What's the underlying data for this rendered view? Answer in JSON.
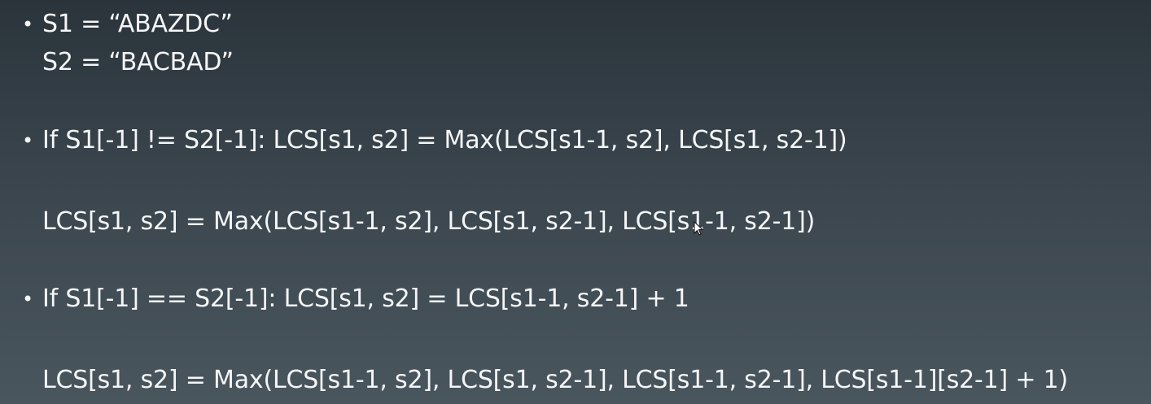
{
  "slide": {
    "bullet_symbol": "•",
    "lines": [
      "S1 =   “ABAZDC”",
      "S2 =   “BACBAD”",
      "If S1[-1] != S2[-1]: LCS[s1, s2] = Max(LCS[s1-1, s2], LCS[s1, s2-1])",
      "LCS[s1, s2] = Max(LCS[s1-1, s2], LCS[s1, s2-1], LCS[s1-1, s2-1])",
      "If S1[-1] == S2[-1]: LCS[s1, s2] = LCS[s1-1, s2-1] + 1",
      "LCS[s1, s2] = Max(LCS[s1-1, s2], LCS[s1, s2-1], LCS[s1-1, s2-1], LCS[s1-1][s2-1] + 1)"
    ]
  },
  "colors": {
    "text": "#f4f6f7",
    "background_top": "#2b343b",
    "background_bottom": "#4a565e"
  },
  "icons": {
    "cursor": "mouse-pointer-icon"
  }
}
